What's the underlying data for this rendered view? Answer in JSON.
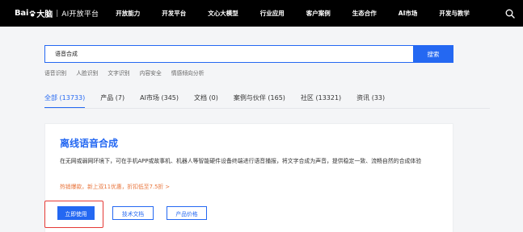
{
  "topbar": {
    "logo": {
      "bai": "Bai",
      "du": "大脑",
      "separator": "|",
      "platform": "AI开放平台"
    },
    "nav": [
      "开放能力",
      "开发平台",
      "文心大模型",
      "行业应用",
      "客户案例",
      "生态合作",
      "AI市场",
      "开发与教学"
    ],
    "search_icon": "search-icon"
  },
  "search": {
    "value": "语音合成",
    "placeholder": "",
    "button_label": "搜索"
  },
  "hot_tags": [
    "语音识别",
    "人脸识别",
    "文字识别",
    "内容安全",
    "情感倾向分析"
  ],
  "tabs": [
    {
      "label": "全部 (13733)",
      "active": true
    },
    {
      "label": "产品 (7)"
    },
    {
      "label": "AI市场 (345)"
    },
    {
      "label": "文档 (0)"
    },
    {
      "label": "案例与伙伴 (165)"
    },
    {
      "label": "社区 (13321)"
    },
    {
      "label": "资讯 (33)"
    }
  ],
  "result": {
    "title": "离线语音合成",
    "description": "在无网或弱网环境下，可在手机APP或故事机、机器人等智能硬件设备终端进行语音播报，将文字合成为声音，提供稳定一致、流畅自然的合成体验",
    "promo": "热销爆款，新上双11优惠，折扣低至7.5折 >",
    "buttons": {
      "primary": "立即使用",
      "docs": "技术文档",
      "price": "产品价格"
    }
  },
  "colors": {
    "brand_blue": "#2468f2",
    "promo_orange": "#e8743b",
    "highlight_red": "#e53935",
    "topbar": "#000000"
  }
}
